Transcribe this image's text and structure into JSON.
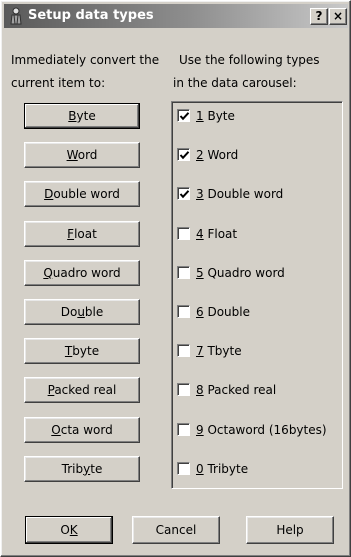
{
  "window": {
    "title": "Setup data types",
    "help_glyph": "?",
    "close_glyph": "×"
  },
  "left_column": {
    "label_line1": "Immediately convert the",
    "label_line2": "current item to:",
    "buttons": [
      {
        "pre": "",
        "mn": "B",
        "post": "yte"
      },
      {
        "pre": "",
        "mn": "W",
        "post": "ord"
      },
      {
        "pre": "",
        "mn": "D",
        "post": "ouble word"
      },
      {
        "pre": "",
        "mn": "F",
        "post": "loat"
      },
      {
        "pre": "",
        "mn": "Q",
        "post": "uadro word"
      },
      {
        "pre": "Do",
        "mn": "u",
        "post": "ble"
      },
      {
        "pre": "",
        "mn": "T",
        "post": "byte"
      },
      {
        "pre": "",
        "mn": "P",
        "post": "acked real"
      },
      {
        "pre": "",
        "mn": "O",
        "post": "cta word"
      },
      {
        "pre": "Trib",
        "mn": "y",
        "post": "te"
      }
    ]
  },
  "right_column": {
    "label_line1": "Use the following types",
    "label_line2": "in the data carousel:",
    "items": [
      {
        "key": "1",
        "text": " Byte",
        "checked": true
      },
      {
        "key": "2",
        "text": " Word",
        "checked": true
      },
      {
        "key": "3",
        "text": " Double word",
        "checked": true
      },
      {
        "key": "4",
        "text": " Float",
        "checked": false
      },
      {
        "key": "5",
        "text": " Quadro word",
        "checked": false
      },
      {
        "key": "6",
        "text": " Double",
        "checked": false
      },
      {
        "key": "7",
        "text": " Tbyte",
        "checked": false
      },
      {
        "key": "8",
        "text": " Packed real",
        "checked": false
      },
      {
        "key": "9",
        "text": " Octaword (16bytes)",
        "checked": false
      },
      {
        "key": "0",
        "text": " Tribyte",
        "checked": false
      }
    ]
  },
  "footer": {
    "ok": {
      "pre": "O",
      "mn": "K",
      "post": ""
    },
    "cancel_label": "Cancel",
    "help_label": "Help"
  }
}
